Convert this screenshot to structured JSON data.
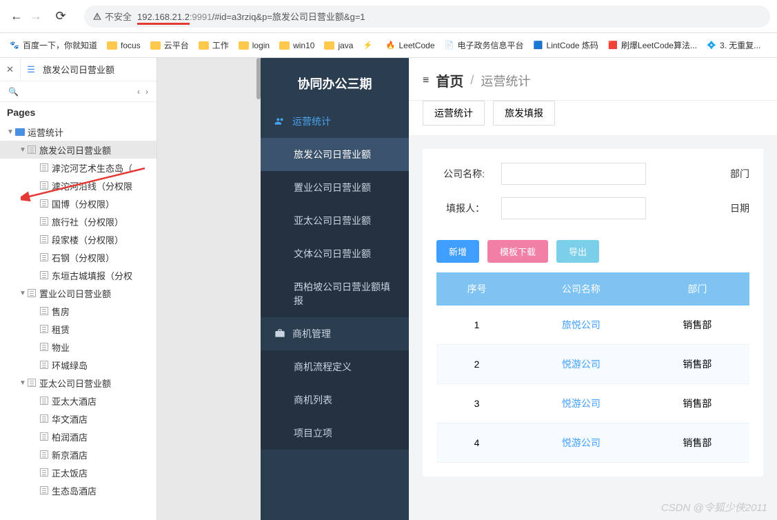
{
  "browser": {
    "insecure_label": "不安全",
    "url_ip": "192.168.21.2",
    "url_port": ":9991",
    "url_rest": "/#id=a3rziq&p=旅发公司日营业额&g=1"
  },
  "bookmarks": [
    {
      "icon": "paw",
      "label": "百度一下，你就知道"
    },
    {
      "icon": "folder",
      "label": "focus"
    },
    {
      "icon": "folder",
      "label": "云平台"
    },
    {
      "icon": "folder",
      "label": "工作"
    },
    {
      "icon": "folder",
      "label": "login"
    },
    {
      "icon": "folder",
      "label": "win10"
    },
    {
      "icon": "folder",
      "label": "java"
    },
    {
      "icon": "lightning",
      "label": ""
    },
    {
      "icon": "flame",
      "label": "LeetCode"
    },
    {
      "icon": "doc",
      "label": "电子政务信息平台"
    },
    {
      "icon": "lint",
      "label": "LintCode 炼码"
    },
    {
      "icon": "red",
      "label": "刷爆LeetCode算法..."
    },
    {
      "icon": "diamond",
      "label": "3. 无重复..."
    }
  ],
  "dev": {
    "tab_title": "旅发公司日营业额",
    "pages_header": "Pages",
    "tree": [
      {
        "depth": 0,
        "tw": "▼",
        "icon": "folder",
        "label": "运营统计"
      },
      {
        "depth": 1,
        "tw": "▼",
        "icon": "page",
        "label": "旅发公司日营业额",
        "sel": true
      },
      {
        "depth": 2,
        "tw": "",
        "icon": "page",
        "label": "滹沱河艺术生态岛（"
      },
      {
        "depth": 2,
        "tw": "",
        "icon": "page",
        "label": "滹沱河沿线（分权限"
      },
      {
        "depth": 2,
        "tw": "",
        "icon": "page",
        "label": "国博（分权限）"
      },
      {
        "depth": 2,
        "tw": "",
        "icon": "page",
        "label": "旅行社（分权限）"
      },
      {
        "depth": 2,
        "tw": "",
        "icon": "page",
        "label": "段家楼（分权限）"
      },
      {
        "depth": 2,
        "tw": "",
        "icon": "page",
        "label": "石钢（分权限）"
      },
      {
        "depth": 2,
        "tw": "",
        "icon": "page",
        "label": "东垣古城填报（分权"
      },
      {
        "depth": 1,
        "tw": "▼",
        "icon": "page",
        "label": "置业公司日营业额"
      },
      {
        "depth": 2,
        "tw": "",
        "icon": "page",
        "label": "售房"
      },
      {
        "depth": 2,
        "tw": "",
        "icon": "page",
        "label": "租赁"
      },
      {
        "depth": 2,
        "tw": "",
        "icon": "page",
        "label": "物业"
      },
      {
        "depth": 2,
        "tw": "",
        "icon": "page",
        "label": "环城绿岛"
      },
      {
        "depth": 1,
        "tw": "▼",
        "icon": "page",
        "label": "亚太公司日营业额"
      },
      {
        "depth": 2,
        "tw": "",
        "icon": "page",
        "label": "亚太大酒店"
      },
      {
        "depth": 2,
        "tw": "",
        "icon": "page",
        "label": "华文酒店"
      },
      {
        "depth": 2,
        "tw": "",
        "icon": "page",
        "label": "柏润酒店"
      },
      {
        "depth": 2,
        "tw": "",
        "icon": "page",
        "label": "新京酒店"
      },
      {
        "depth": 2,
        "tw": "",
        "icon": "page",
        "label": "正太饭店"
      },
      {
        "depth": 2,
        "tw": "",
        "icon": "page",
        "label": "生态岛酒店"
      }
    ]
  },
  "sidebar": {
    "title": "协同办公三期",
    "groups": [
      {
        "icon": "users",
        "label": "运营统计",
        "active": true,
        "subs": [
          {
            "label": "旅发公司日营业额",
            "active": true
          },
          {
            "label": "置业公司日营业额"
          },
          {
            "label": "亚太公司日营业额"
          },
          {
            "label": "文体公司日营业额"
          },
          {
            "label": "西柏坡公司日营业额填报"
          }
        ]
      },
      {
        "icon": "briefcase",
        "label": "商机管理",
        "subs": [
          {
            "label": "商机流程定义"
          },
          {
            "label": "商机列表"
          },
          {
            "label": "项目立项"
          }
        ]
      }
    ]
  },
  "main": {
    "crumb_home": "首页",
    "crumb_current": "运营统计",
    "tabs": [
      {
        "label": "运营统计"
      },
      {
        "label": "旅发填报"
      }
    ],
    "form": {
      "company_lbl": "公司名称:",
      "dept_lbl": "部门",
      "reporter_lbl": "填报人：",
      "date_lbl": "日期"
    },
    "buttons": {
      "add": "新增",
      "template": "模板下载",
      "export": "导出"
    },
    "table": {
      "headers": [
        "序号",
        "公司名称",
        "部门"
      ],
      "rows": [
        {
          "idx": "1",
          "company": "旅悦公司",
          "dept": "销售部"
        },
        {
          "idx": "2",
          "company": "悦游公司",
          "dept": "销售部"
        },
        {
          "idx": "3",
          "company": "悦游公司",
          "dept": "销售部"
        },
        {
          "idx": "4",
          "company": "悦游公司",
          "dept": "销售部"
        }
      ]
    }
  },
  "watermark": "CSDN @令狐少侠2011"
}
